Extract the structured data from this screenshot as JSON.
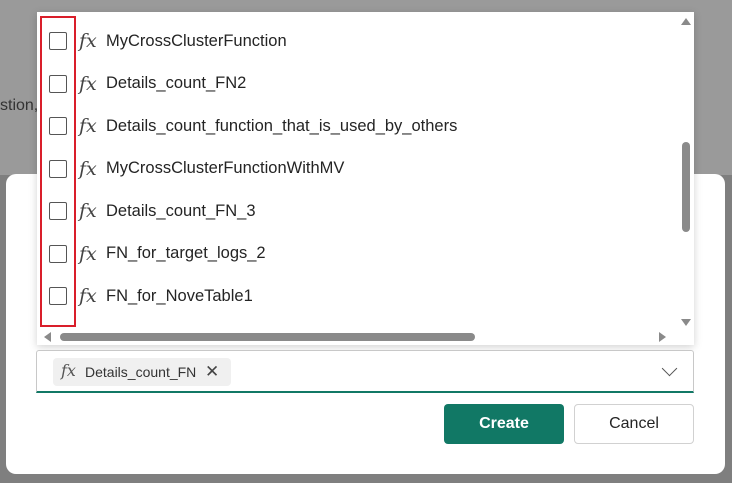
{
  "background": {
    "partial_text": "stion,"
  },
  "list": {
    "items": [
      {
        "label": "MyCrossClusterFunction",
        "checked": false,
        "icon": "function-icon"
      },
      {
        "label": "Details_count_FN2",
        "checked": false,
        "icon": "function-icon"
      },
      {
        "label": "Details_count_function_that_is_used_by_others",
        "checked": false,
        "icon": "function-icon"
      },
      {
        "label": "MyCrossClusterFunctionWithMV",
        "checked": false,
        "icon": "function-icon"
      },
      {
        "label": "Details_count_FN_3",
        "checked": false,
        "icon": "function-icon"
      },
      {
        "label": "FN_for_target_logs_2",
        "checked": false,
        "icon": "function-icon"
      },
      {
        "label": "FN_for_NoveTable1",
        "checked": false,
        "icon": "function-icon"
      }
    ],
    "fx_glyph": "fx"
  },
  "select": {
    "selected_chip": {
      "label": "Details_count_FN",
      "icon": "function-icon",
      "remove_glyph": "✕"
    }
  },
  "buttons": {
    "create_label": "Create",
    "cancel_label": "Cancel"
  },
  "colors": {
    "accent": "#117865",
    "highlight": "#d91e2a"
  }
}
